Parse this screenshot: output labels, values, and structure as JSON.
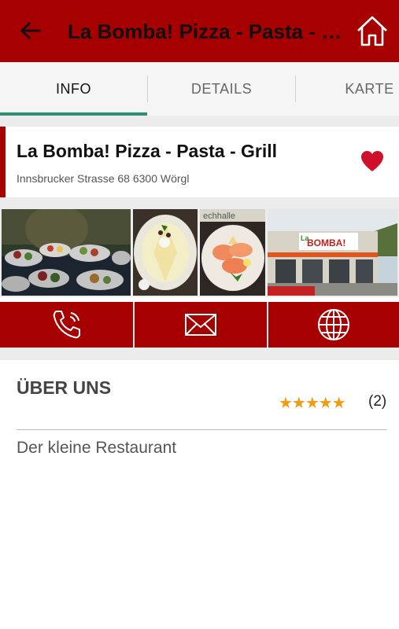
{
  "appbar": {
    "title": "La Bomba! Pizza - Pasta - Grill",
    "back_icon": "arrow-left-icon",
    "home_icon": "home-icon",
    "background": "#a70000"
  },
  "tabs": [
    {
      "label": "INFO",
      "active": true
    },
    {
      "label": "DETAILS",
      "active": false
    },
    {
      "label": "KARTE",
      "active": false
    }
  ],
  "restaurant": {
    "name": "La Bomba! Pizza - Pasta - Grill",
    "address": "Innsbrucker Strasse 68 6300 Wörgl",
    "favorite_icon": "heart-icon",
    "favorite": true,
    "photos": [
      {
        "alt": "buffet-photo"
      },
      {
        "alt": "cheese-plate-photo"
      },
      {
        "alt": "salmon-plate-photo"
      },
      {
        "alt": "restaurant-exterior-photo"
      }
    ],
    "photo_text": {
      "sign": "BOMBA!",
      "sign_small": "La",
      "banner": "echhalle"
    }
  },
  "actions": [
    {
      "name": "call",
      "icon": "phone-icon"
    },
    {
      "name": "email",
      "icon": "envelope-icon"
    },
    {
      "name": "website",
      "icon": "globe-icon"
    }
  ],
  "about": {
    "heading": "ÜBER UNS",
    "stars": "★★★★★",
    "rating": 5,
    "review_count": "(2)",
    "description": "Der kleine Restaurant"
  },
  "colors": {
    "accent": "#a70000",
    "tab_indicator": "#2b8f73",
    "star": "#f29b10",
    "heart": "#d0102a"
  }
}
